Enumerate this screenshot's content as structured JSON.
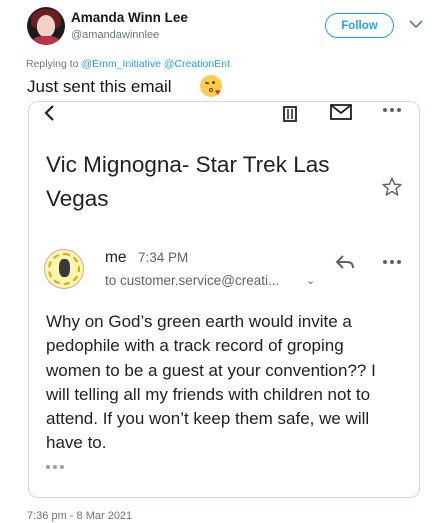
{
  "tweet": {
    "display_name": "Amanda Winn Lee",
    "handle": "@amandawinnlee",
    "follow_label": "Follow",
    "replying_prefix": "Replying to ",
    "replying_mentions": "@Emm_Initiative @CreationEnt",
    "text": "Just sent this email",
    "emoji": "kissing-face-with-heart",
    "timestamp": "7:36 pm - 8 Mar 2021"
  },
  "email": {
    "subject": "Vic Mignogna- Star Trek Las Vegas",
    "sender": "me",
    "time": "7:34 PM",
    "recipient": "to customer.service@creati...",
    "recipient_chevron": "⌄",
    "body": "Why on God’s green earth would invite a pedophile with a track record of groping women to be a guest at your convention?? I will telling all my friends with children not to attend. If you won’t keep them safe, we will have to.",
    "icons": [
      "back-arrow-icon",
      "trash-icon",
      "mail-icon",
      "more-icon",
      "star-icon",
      "reply-icon",
      "more-icon"
    ]
  },
  "colors": {
    "link_blue": "#1da1f2",
    "secondary_text": "#657786",
    "gmail_grey": "#5f6368"
  }
}
